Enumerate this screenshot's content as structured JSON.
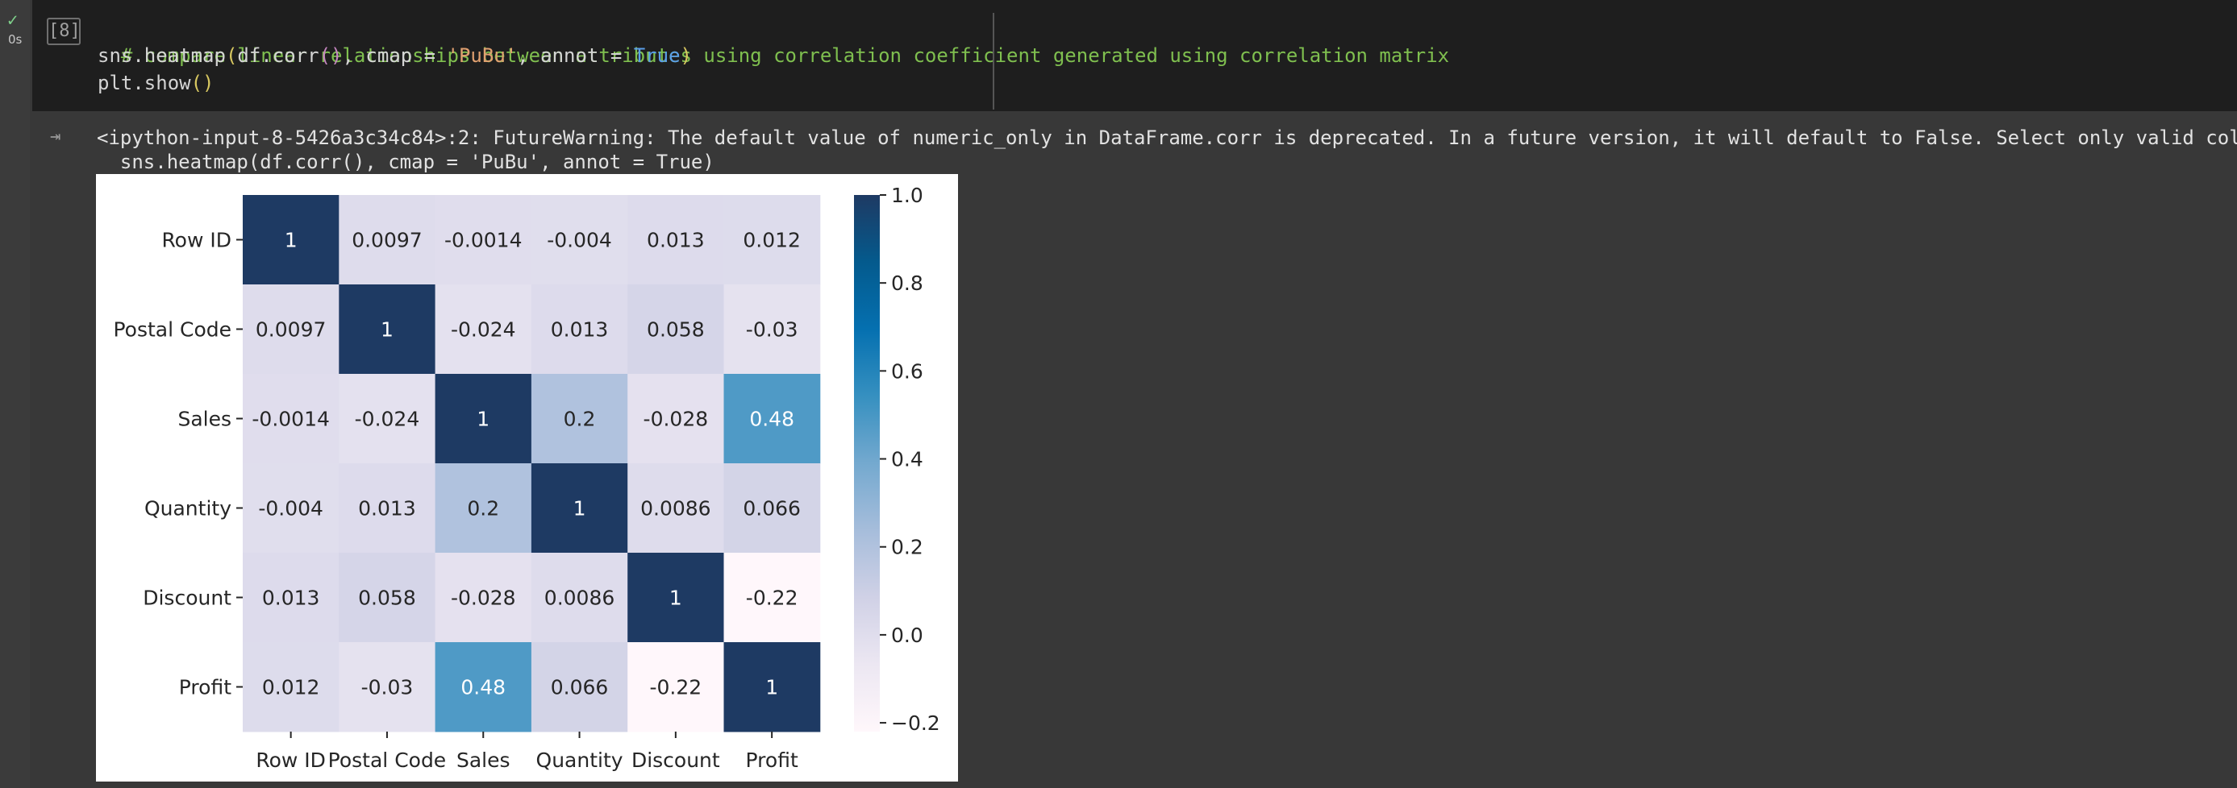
{
  "cell": {
    "run_status_icon": "check-icon",
    "run_time": "0s",
    "execution_count": "[8]",
    "code": {
      "line1_comment": "# compare linear relationships between attributes using correlation coefficient generated using correlation matrix",
      "line2": {
        "a": "sns.heatmap",
        "b": "(",
        "c": "df.corr",
        "d": "()",
        "e": ", cmap = ",
        "f": "'PuBu'",
        "g": ", annot = ",
        "h": "True",
        "i": ")"
      },
      "line3": {
        "a": "plt.show",
        "b": "()"
      }
    }
  },
  "output": {
    "icon": "output-redirect-icon",
    "warning_line1": "<ipython-input-8-5426a3c34c84>:2: FutureWarning: The default value of numeric_only in DataFrame.corr is deprecated. In a future version, it will default to False. Select only valid columns or",
    "warning_line2": "  sns.heatmap(df.corr(), cmap = 'PuBu', annot = True)"
  },
  "chart_data": {
    "type": "heatmap",
    "title": "",
    "xlabel": "",
    "ylabel": "",
    "colormap": "PuBu",
    "x_categories": [
      "Row ID",
      "Postal Code",
      "Sales",
      "Quantity",
      "Discount",
      "Profit"
    ],
    "y_categories": [
      "Row ID",
      "Postal Code",
      "Sales",
      "Quantity",
      "Discount",
      "Profit"
    ],
    "values": [
      [
        1,
        0.0097,
        -0.0014,
        -0.004,
        0.013,
        0.012
      ],
      [
        0.0097,
        1,
        -0.024,
        0.013,
        0.058,
        -0.03
      ],
      [
        -0.0014,
        -0.024,
        1,
        0.2,
        -0.028,
        0.48
      ],
      [
        -0.004,
        0.013,
        0.2,
        1,
        0.0086,
        0.066
      ],
      [
        0.013,
        0.058,
        -0.028,
        0.0086,
        1,
        -0.22
      ],
      [
        0.012,
        -0.03,
        0.48,
        0.066,
        -0.22,
        1
      ]
    ],
    "annotations": [
      [
        "1",
        "0.0097",
        "-0.0014",
        "-0.004",
        "0.013",
        "0.012"
      ],
      [
        "0.0097",
        "1",
        "-0.024",
        "0.013",
        "0.058",
        "-0.03"
      ],
      [
        "-0.0014",
        "-0.024",
        "1",
        "0.2",
        "-0.028",
        "0.48"
      ],
      [
        "-0.004",
        "0.013",
        "0.2",
        "1",
        "0.0086",
        "0.066"
      ],
      [
        "0.013",
        "0.058",
        "-0.028",
        "0.0086",
        "1",
        "-0.22"
      ],
      [
        "0.012",
        "-0.03",
        "0.48",
        "0.066",
        "-0.22",
        "1"
      ]
    ],
    "colorbar": {
      "range": [
        -0.22,
        1.0
      ],
      "ticks": [
        1.0,
        0.8,
        0.6,
        0.4,
        0.2,
        0.0,
        -0.2
      ],
      "tick_labels": [
        "1.0",
        "0.8",
        "0.6",
        "0.4",
        "0.2",
        "0.0",
        "−0.2"
      ]
    },
    "colorbar_stops": [
      "#fff7fb",
      "#ece7f2",
      "#d0d1e6",
      "#a6bddb",
      "#74a9cf",
      "#3690c0",
      "#0570b0",
      "#045a8d",
      "#1e3a63"
    ]
  }
}
